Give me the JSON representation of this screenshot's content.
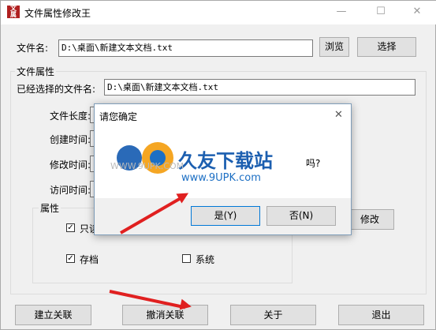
{
  "window": {
    "title": "文件属性修改王",
    "minimize_glyph": "—",
    "maximize_glyph": "☐",
    "close_glyph": "✕"
  },
  "file_row": {
    "label": "文件名:",
    "value": "D:\\桌面\\新建文本文档.txt",
    "browse_label": "浏览",
    "select_label": "选择"
  },
  "attributes_section": {
    "title": "文件属性",
    "selected_label": "已经选择的文件名:",
    "selected_value": "D:\\桌面\\新建文本文档.txt",
    "length_label": "文件长度:",
    "created_label": "创建时间:",
    "modified_label": "修改时间:",
    "accessed_label": "访问时间:",
    "modify_button": "修改"
  },
  "props_group": {
    "title": "属性",
    "readonly_label": "只读",
    "readonly_checked": true,
    "archive_label": "存档",
    "archive_checked": true,
    "system_label": "系统",
    "system_checked": false
  },
  "bottom_buttons": {
    "associate": "建立关联",
    "disassociate": "撤消关联",
    "about": "关于",
    "exit": "退出"
  },
  "dialog": {
    "title": "请您确定",
    "question_tail": "吗?",
    "yes": "是(Y)",
    "no": "否(N)",
    "close_glyph": "✕"
  },
  "watermark": {
    "brand": "久友下载站",
    "url": "www.9UPK.com",
    "faint": "WWW.9UPK.COM"
  },
  "accent_colors": {
    "arrow": "#e02020",
    "focus": "#0078d7"
  }
}
